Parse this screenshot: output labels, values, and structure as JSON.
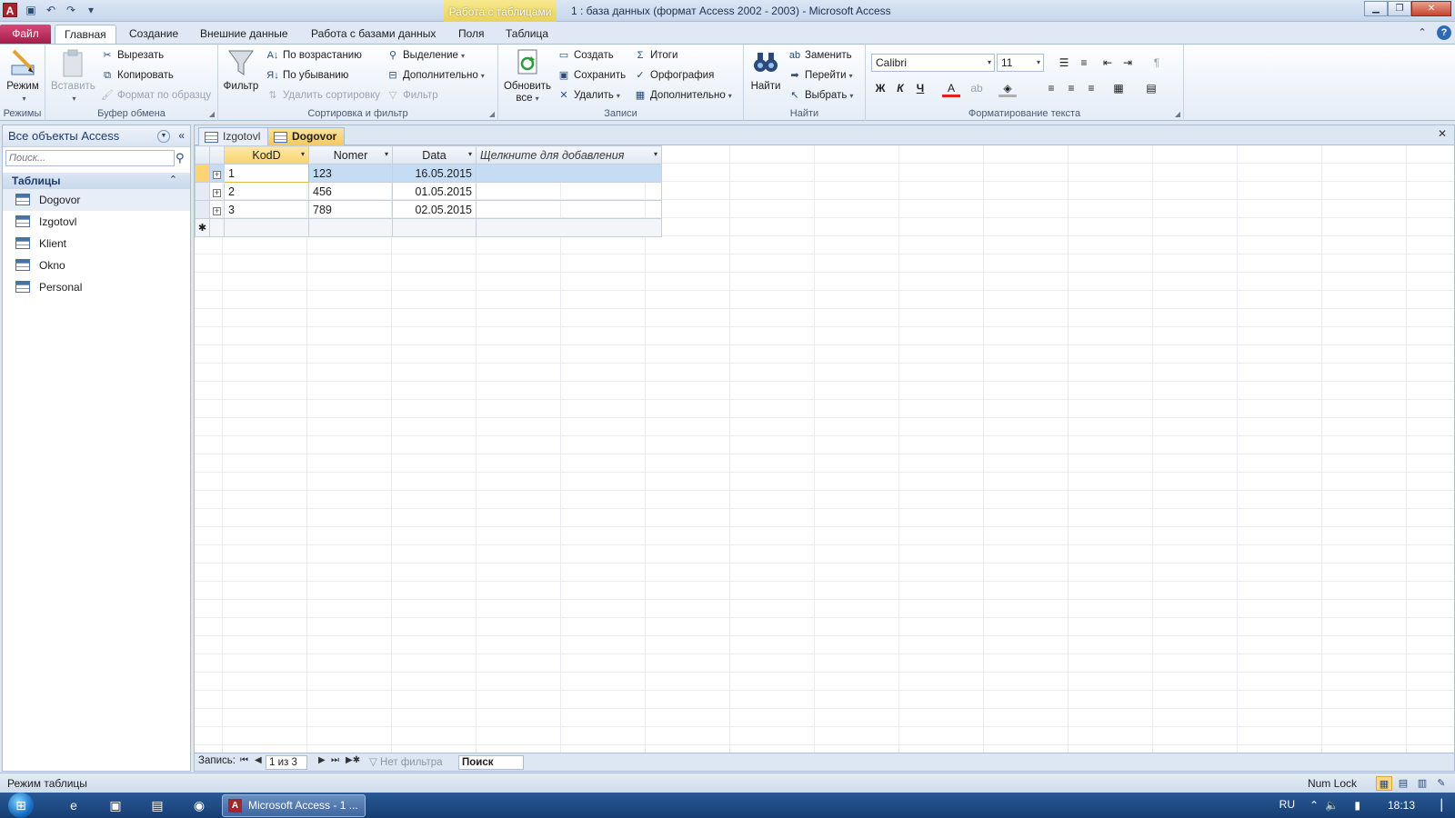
{
  "app": {
    "title": "1 : база данных (формат Access 2002 - 2003)  -  Microsoft Access",
    "context_tab": "Работа с таблицами",
    "icon": "access-icon"
  },
  "ribbon_tabs": [
    "Файл",
    "Главная",
    "Создание",
    "Внешние данные",
    "Работа с базами данных",
    "Поля",
    "Таблица"
  ],
  "ribbon": {
    "views": {
      "mode": "Режим",
      "group": "Режимы"
    },
    "clipboard": {
      "paste": "Вставить",
      "cut": "Вырезать",
      "copy": "Копировать",
      "format_painter": "Формат по образцу",
      "group": "Буфер обмена"
    },
    "sort_filter": {
      "filter": "Фильтр",
      "ascending": "По возрастанию",
      "descending": "По убыванию",
      "remove_sort": "Удалить сортировку",
      "selection": "Выделение",
      "advanced": "Дополнительно",
      "toggle_filter": "Фильтр",
      "group": "Сортировка и фильтр"
    },
    "records": {
      "refresh": "Обновить",
      "refresh2": "все",
      "new": "Создать",
      "save": "Сохранить",
      "delete": "Удалить",
      "totals": "Итоги",
      "spelling": "Орфография",
      "more": "Дополнительно",
      "group": "Записи"
    },
    "find": {
      "find": "Найти",
      "replace": "Заменить",
      "goto": "Перейти",
      "select": "Выбрать",
      "group": "Найти"
    },
    "text_format": {
      "font": "Calibri",
      "size": "11",
      "bold": "Ж",
      "italic": "К",
      "underline": "Ч",
      "group": "Форматирование текста"
    }
  },
  "nav": {
    "title": "Все объекты Access",
    "search_placeholder": "Поиск...",
    "group": "Таблицы",
    "items": [
      "Dogovor",
      "Izgotovl",
      "Klient",
      "Okno",
      "Personal"
    ]
  },
  "doc_tabs": [
    "Izgotovl",
    "Dogovor"
  ],
  "table": {
    "columns": [
      "KodD",
      "Nomer",
      "Data",
      "Щелкните для добавления"
    ],
    "rows": [
      [
        "1",
        "123",
        "16.05.2015"
      ],
      [
        "2",
        "456",
        "01.05.2015"
      ],
      [
        "3",
        "789",
        "02.05.2015"
      ]
    ]
  },
  "record_nav": {
    "label": "Запись:",
    "position": "1 из 3",
    "filter": "Нет фильтра",
    "search": "Поиск"
  },
  "status": {
    "mode": "Режим таблицы",
    "numlock": "Num Lock"
  },
  "taskbar": {
    "task": "Microsoft Access - 1 ...",
    "lang": "RU",
    "time": "18:13"
  }
}
